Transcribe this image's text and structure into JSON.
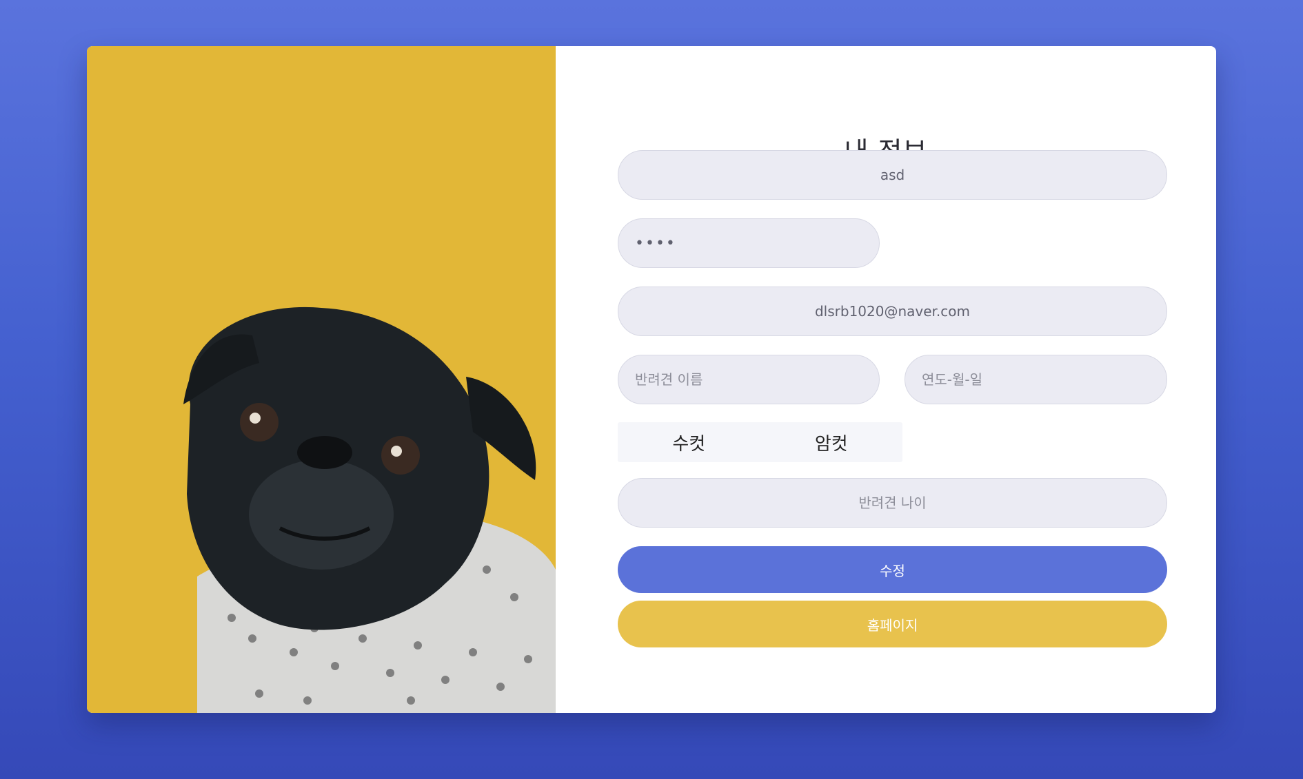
{
  "colors": {
    "background": "#4460cf",
    "photo_background": "#e2b737",
    "primary_button": "#5b72d9",
    "secondary_button": "#e8c24d"
  },
  "photo": {
    "subject": "pug-in-knit-sweater"
  },
  "form": {
    "title": "내 정보",
    "username": {
      "value": "asd"
    },
    "password": {
      "value": "1234"
    },
    "email": {
      "value": "dlsrb1020@naver.com"
    },
    "pet_name": {
      "placeholder": "반려견 이름"
    },
    "birthdate": {
      "placeholder": "연도-월-일"
    },
    "gender": {
      "male_label": "수컷",
      "female_label": "암컷"
    },
    "pet_age": {
      "placeholder": "반려견 나이"
    },
    "edit_button_label": "수정",
    "home_button_label": "홈페이지"
  }
}
